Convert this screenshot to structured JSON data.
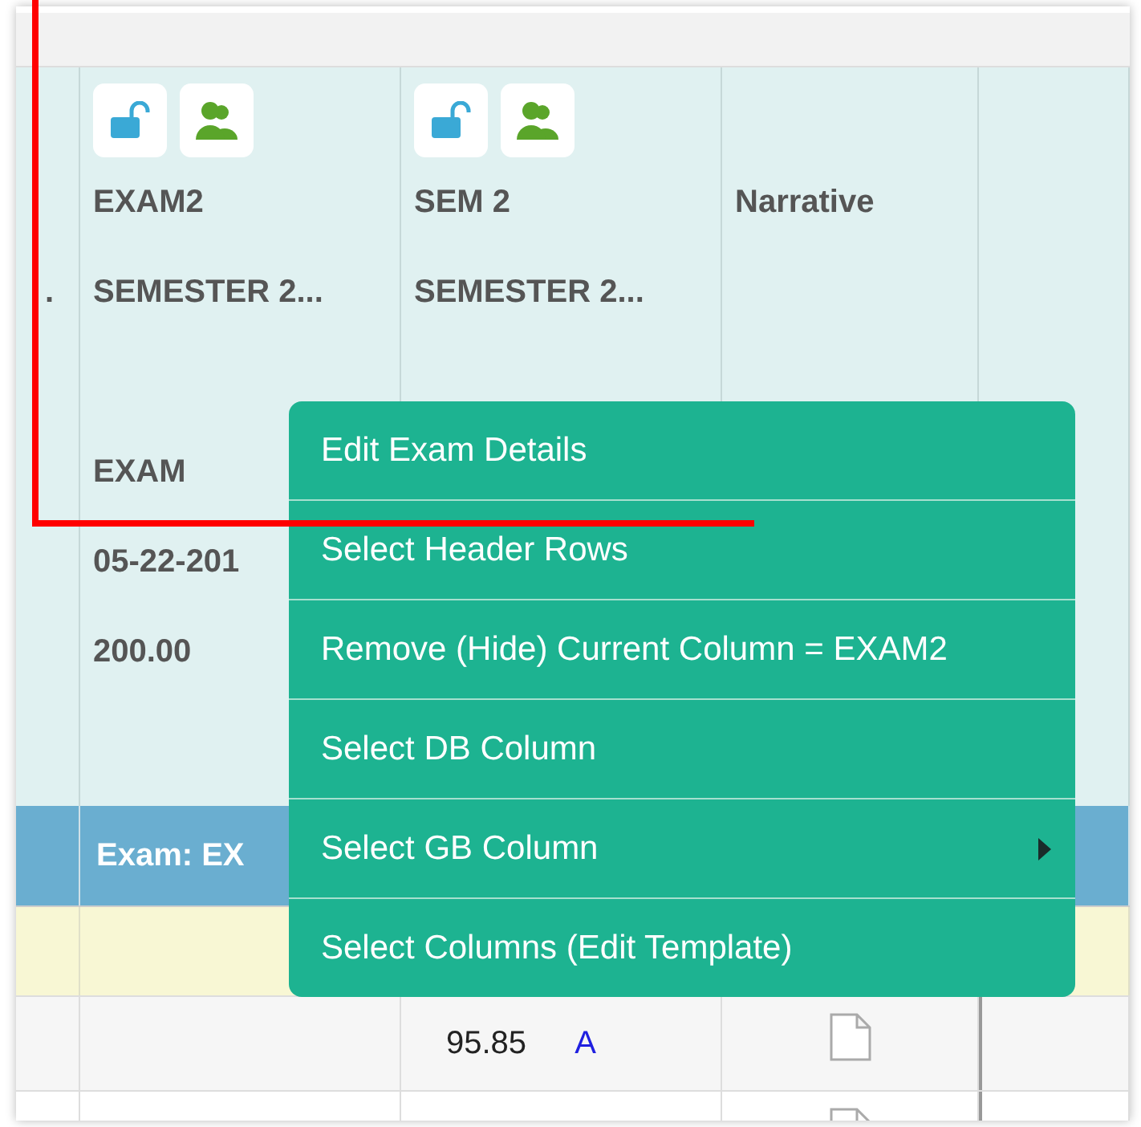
{
  "header_columns": [
    {
      "has_icons": false,
      "subtitle": "."
    },
    {
      "has_icons": true,
      "title": "EXAM2",
      "subtitle": "SEMESTER 2...",
      "type": "EXAM",
      "date": "05-22-201",
      "points": "200.00"
    },
    {
      "has_icons": true,
      "title": "SEM 2",
      "subtitle": "SEMESTER 2..."
    },
    {
      "has_icons": false,
      "title": "Narrative"
    },
    {
      "has_icons": false
    }
  ],
  "group_band": {
    "label": "Exam: EX"
  },
  "rows": [
    {
      "score": "95.85",
      "grade": "A",
      "has_note": true
    },
    {
      "has_note": true
    }
  ],
  "context_menu": [
    {
      "label": "Edit Exam Details",
      "has_submenu": false
    },
    {
      "label": "Select Header Rows",
      "has_submenu": false
    },
    {
      "label": "Remove (Hide) Current Column = EXAM2",
      "has_submenu": false
    },
    {
      "label": "Select DB Column",
      "has_submenu": false
    },
    {
      "label": "Select GB Column",
      "has_submenu": true
    },
    {
      "label": "Select Columns (Edit Template)",
      "has_submenu": false
    }
  ]
}
